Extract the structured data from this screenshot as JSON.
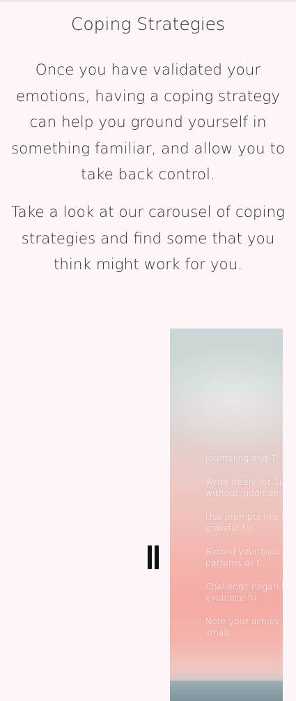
{
  "section": {
    "title": "Coping Strategies",
    "paragraphs": [
      "Once you have validated your emotions, having a coping strategy can help you ground yourself in something familiar, and allow you to take back control.",
      "Take a look at our carousel of coping strategies and find some that you think might work for you."
    ]
  },
  "carousel": {
    "pause_icon": "pause-icon",
    "slide": {
      "heading": "Journaling and T",
      "items": [
        "Write freely for 10 without judgmen",
        "Use prompts like \"I'm grateful for...",
        "Record your thou any patterns or t",
        "Challenge negati there evidence fo",
        "Note your achiev how small."
      ]
    }
  }
}
